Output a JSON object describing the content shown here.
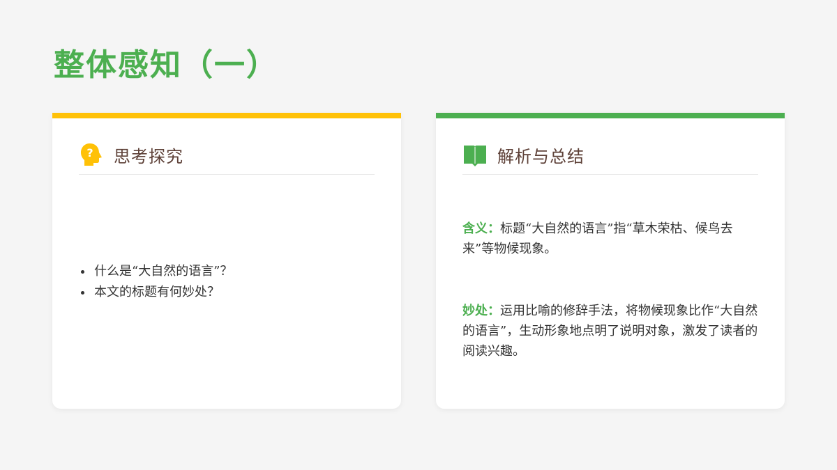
{
  "page": {
    "title": "整体感知（一）"
  },
  "left_card": {
    "accent_color": "#ffc107",
    "icon": "head-question-icon",
    "heading": "思考探究",
    "questions": [
      "什么是“大自然的语言”？",
      "本文的标题有何妙处？"
    ]
  },
  "right_card": {
    "accent_color": "#4caf50",
    "icon": "open-book-icon",
    "heading": "解析与总结",
    "meaning": {
      "label": "含义：",
      "text": "标题“大自然的语言”指“草木荣枯、候鸟去来”等物候现象。"
    },
    "merit": {
      "label": "妙处：",
      "text": "运用比喻的修辞手法，将物候现象比作“大自然的语言”，生动形象地点明了说明对象，激发了读者的阅读兴趣。"
    }
  },
  "colors": {
    "title": "#4caf50",
    "heading": "#5d4037",
    "body_text": "#333333",
    "background": "#f5f5f5"
  }
}
